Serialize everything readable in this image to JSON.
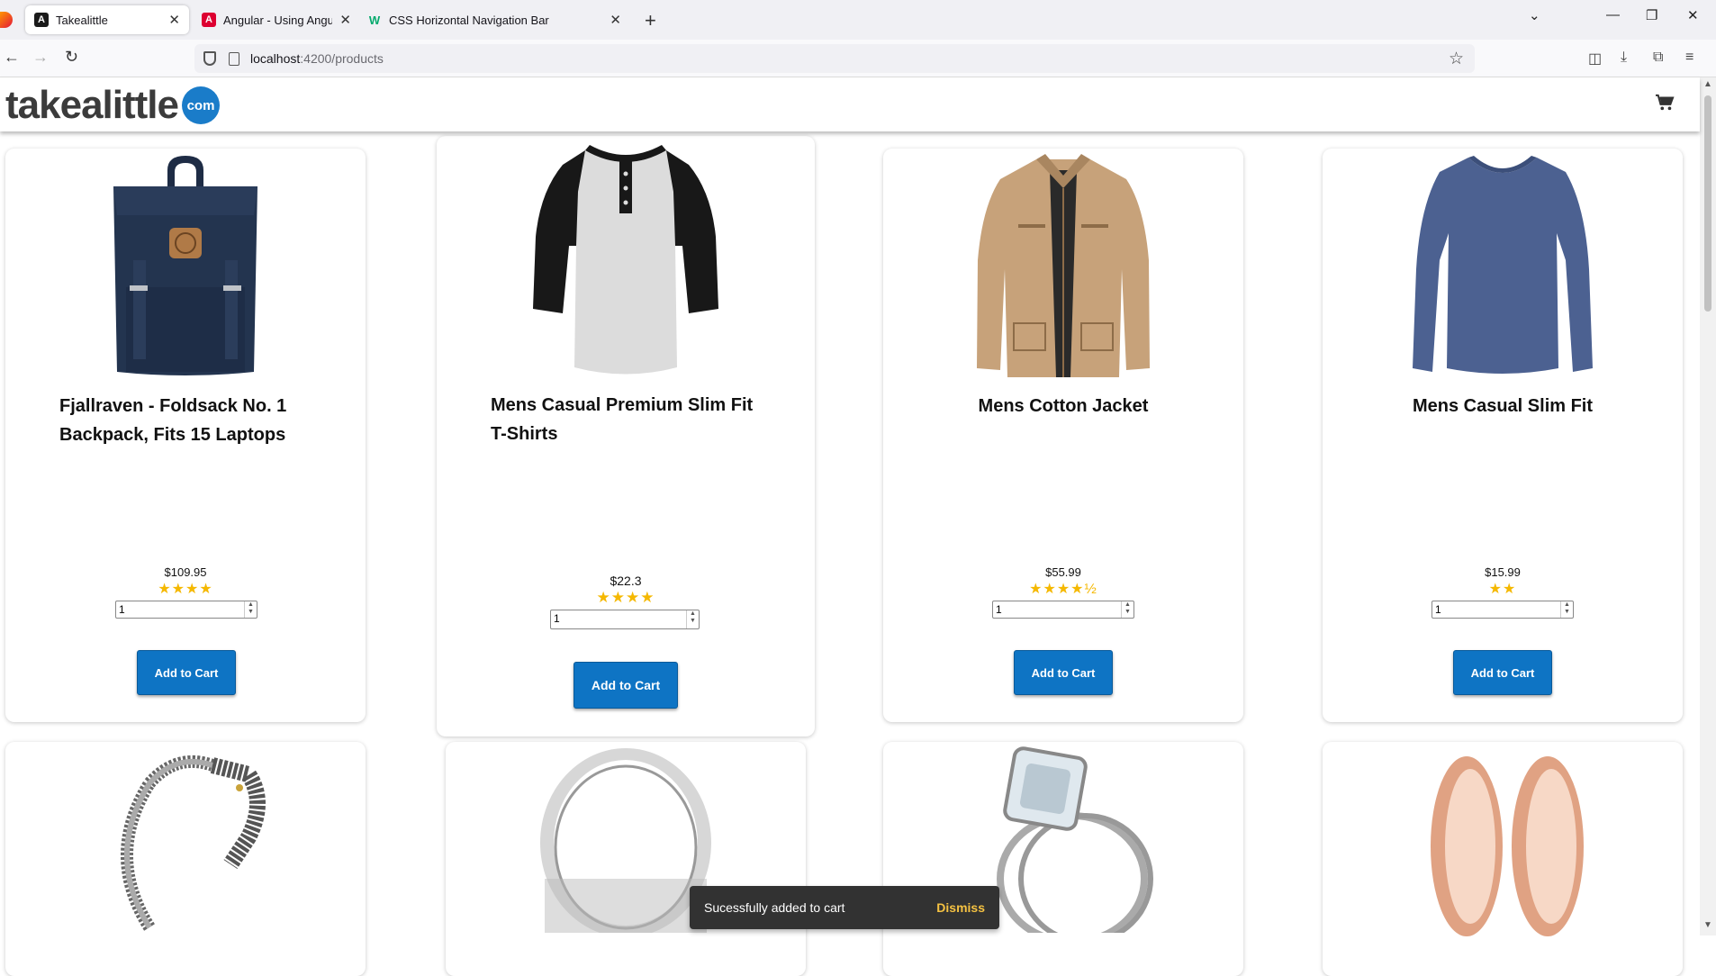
{
  "browser": {
    "tabs": [
      {
        "title": "Takealittle",
        "active": true,
        "favicon": "angular-icon",
        "color": "#1a1a1a"
      },
      {
        "title": "Angular - Using Angular routes",
        "active": false,
        "favicon": "angular-icon",
        "color": "#dd0031"
      },
      {
        "title": "CSS Horizontal Navigation Bar",
        "active": false,
        "favicon": "w3schools-icon",
        "color": "#04aa6d"
      }
    ],
    "url_host": "localhost",
    "url_path": ":4200/products"
  },
  "site": {
    "logo_text": "takealittle",
    "logo_badge": "com"
  },
  "products": [
    {
      "title": "Fjallraven - Foldsack No. 1 Backpack, Fits 15 Laptops",
      "price": "$109.95",
      "stars": "★★★★",
      "rating": 4,
      "qty": "1",
      "button": "Add to Cart",
      "image": "backpack"
    },
    {
      "title": "Mens Casual Premium Slim Fit T-Shirts",
      "price": "$22.3",
      "stars": "★★★★",
      "rating": 4,
      "qty": "1",
      "button": "Add to Cart",
      "image": "raglan-tshirt"
    },
    {
      "title": "Mens Cotton Jacket",
      "price": "$55.99",
      "stars": "★★★★½",
      "rating": 4.5,
      "qty": "1",
      "button": "Add to Cart",
      "image": "jacket"
    },
    {
      "title": "Mens Casual Slim Fit",
      "price": "$15.99",
      "stars": "★★",
      "rating": 2,
      "qty": "1",
      "button": "Add to Cart",
      "image": "longsleeve-shirt"
    }
  ],
  "products_row2": [
    {
      "image": "dragon-bracelet"
    },
    {
      "image": "silver-ring"
    },
    {
      "image": "diamond-ring"
    },
    {
      "image": "rose-gold-tunnels"
    }
  ],
  "snackbar": {
    "message": "Sucessfully added to cart",
    "action": "Dismiss"
  }
}
